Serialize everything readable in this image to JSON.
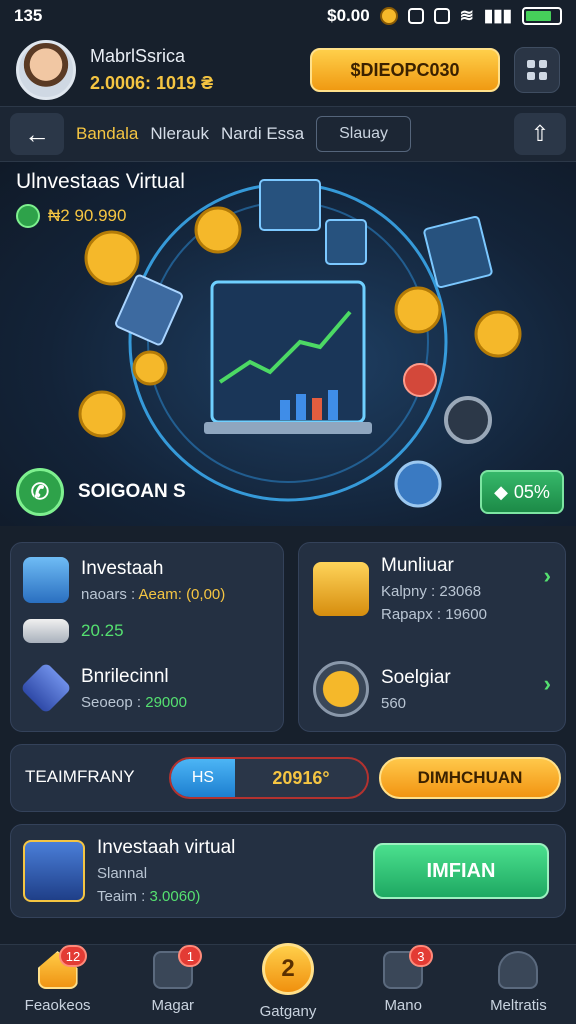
{
  "status": {
    "time": "135",
    "balance": "$0.00"
  },
  "profile": {
    "name": "MabrlSsrica",
    "balance": "2.0006: 1019 ₴"
  },
  "header": {
    "gold_button": "$DIEOPC030"
  },
  "nav": {
    "back": "←",
    "tabs": [
      "Bandala",
      "Nlerauk",
      "Nardi Essa"
    ],
    "box_tab": "Slauay"
  },
  "hero": {
    "title": "Ulnvestaas Virtual",
    "balance": "₦2 90.990",
    "left_button": "SOIGOAN S",
    "pct_button": "05%"
  },
  "cards": {
    "left": [
      {
        "title": "Investaah",
        "label": "naoars :",
        "value": "Aeam: (0,00)"
      },
      {
        "title": "",
        "label": "",
        "value": "20.25"
      },
      {
        "title": "Bnrilecinnl",
        "label": "Seoeop :",
        "value": "29000"
      }
    ],
    "right": [
      {
        "title": "Munliuar",
        "line1": "Kalpny : 23068",
        "line2": "Rapapx : 19600"
      },
      {
        "title": "Soelgiar",
        "value": "560"
      }
    ]
  },
  "actionbar": {
    "label": "TEAIMFRANY",
    "pill_left": "HS",
    "pill_right": "20916°",
    "orange": "DIMHCHUAN"
  },
  "bottom_card": {
    "title": "Investaah virtual",
    "line1": "Slannal",
    "label": "Teaim :",
    "value": "3.0060)",
    "button": "IMFIAN"
  },
  "bottomnav": [
    {
      "label": "Feaokeos",
      "badge": "12"
    },
    {
      "label": "Magar",
      "badge": "1"
    },
    {
      "label": "Gatgany",
      "center": "2"
    },
    {
      "label": "Mano",
      "badge": "3"
    },
    {
      "label": "Meltratis"
    }
  ],
  "colors": {
    "gold": "#f5c542",
    "green": "#55e070",
    "panel": "#243042",
    "bg": "#17202c"
  }
}
